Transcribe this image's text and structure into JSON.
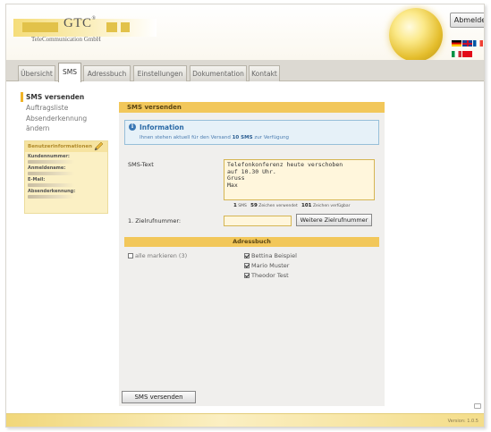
{
  "header": {
    "logo_text": "GTC",
    "logo_mark": "®",
    "tagline": "TeleCommunication GmbH",
    "logout_label": "Abmelden",
    "languages": [
      "german-flag-icon",
      "uk-flag-icon",
      "french-flag-icon",
      "italian-flag-icon",
      "turkish-flag-icon"
    ]
  },
  "tabs": [
    {
      "label": "Übersicht",
      "active": false
    },
    {
      "label": "SMS",
      "active": true
    },
    {
      "label": "Adressbuch",
      "active": false
    },
    {
      "label": "Einstellungen",
      "active": false
    },
    {
      "label": "Dokumentation",
      "active": false
    },
    {
      "label": "Kontakt",
      "active": false
    }
  ],
  "sidebar": {
    "items": [
      {
        "label": "SMS versenden",
        "active": true
      },
      {
        "label": "Auftragsliste",
        "active": false
      },
      {
        "label": "Absenderkennung ändern",
        "active": false
      }
    ],
    "user_box": {
      "title": "Benutzerinformationen",
      "fields": [
        {
          "label": "Kundennummer:"
        },
        {
          "label": "Anmeldename:"
        },
        {
          "label": "E-Mail:"
        },
        {
          "label": "Absenderkennung:"
        }
      ]
    }
  },
  "main": {
    "panel_title": "SMS versenden",
    "info": {
      "title": "Information",
      "text_prefix": "Ihnen stehen aktuell für den Versand",
      "sms_count": "10 SMS",
      "text_suffix": "zur Verfügung"
    },
    "sms_text_label": "SMS-Text",
    "sms_text_value": "Telefonkonferenz heute verschoben\nauf 10.30 Uhr.\nGruss\nMax",
    "counter": {
      "sms_count": "1",
      "sms_label": "SMS",
      "used_count": "59",
      "used_label": "Zeichen verwendet",
      "avail_count": "101",
      "avail_label": "Zeichen verfügbar"
    },
    "recipient_label": "1. Zielrufnummer:",
    "recipient_value": "",
    "more_recipient_label": "Weitere Zielrufnummer",
    "addressbook": {
      "title": "Adressbuch",
      "mark_all_label": "alle markieren (3)",
      "mark_all_checked": false,
      "contacts": [
        {
          "name": "Bettina Beispiel",
          "checked": true
        },
        {
          "name": "Mario Muster",
          "checked": true
        },
        {
          "name": "Theodor Test",
          "checked": true
        }
      ]
    },
    "send_label": "SMS versenden"
  },
  "footer": {
    "version": "Version: 1.0.5"
  }
}
